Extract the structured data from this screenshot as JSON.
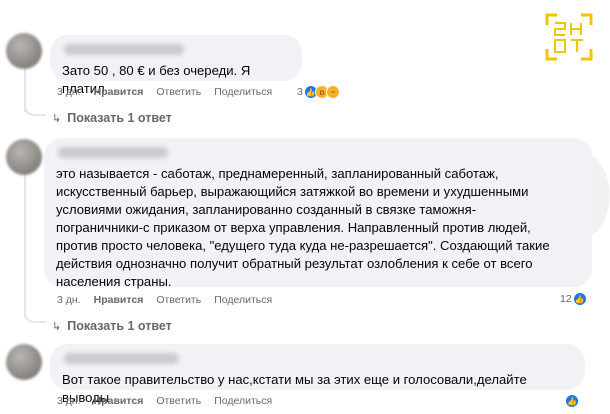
{
  "comments": [
    {
      "text": "Зато 50 , 80 € и без очереди. Я платил",
      "time": "3 дн.",
      "like": "Нравится",
      "reply": "Ответить",
      "share": "Поделиться",
      "reaction_count": "3",
      "reactions": [
        "like-icon",
        "wow-icon",
        "sad-icon"
      ]
    },
    {
      "text": "это называется - саботаж, преднамеренный, запланированный саботаж,\nискусственный барьер, выражающийся затяжкой во времени и ухудшенными\nусловиями ожидания, запланированно созданный в связке таможня-\nпограничники-с приказом от верха управления. Направленный против людей,\nпротив просто человека, \"едущего туда куда не-разрешается\". Создающий такие\nдействия однозначно получит обратный результат озлобления к себе от всего\nнаселения страны.",
      "time": "3 дн.",
      "like": "Нравится",
      "reply": "Ответить",
      "share": "Поделиться",
      "reaction_count": "12",
      "reactions": [
        "like-icon"
      ]
    },
    {
      "text": "Вот такое правительство у нас,кстати мы за этих еще и голосовали,делайте выводы",
      "time": "3 дн.",
      "like": "Нравится",
      "reply": "Ответить",
      "share": "Поделиться",
      "reaction_count": "",
      "reactions": [
        "like-icon"
      ]
    }
  ],
  "replies": [
    {
      "label": "Показать 1 ответ"
    },
    {
      "label": "Показать 1 ответ"
    }
  ],
  "colors": {
    "bubble": "#f0f2f5",
    "meta": "#65676b",
    "like": "#1877f2",
    "logo": "#f5c400"
  }
}
